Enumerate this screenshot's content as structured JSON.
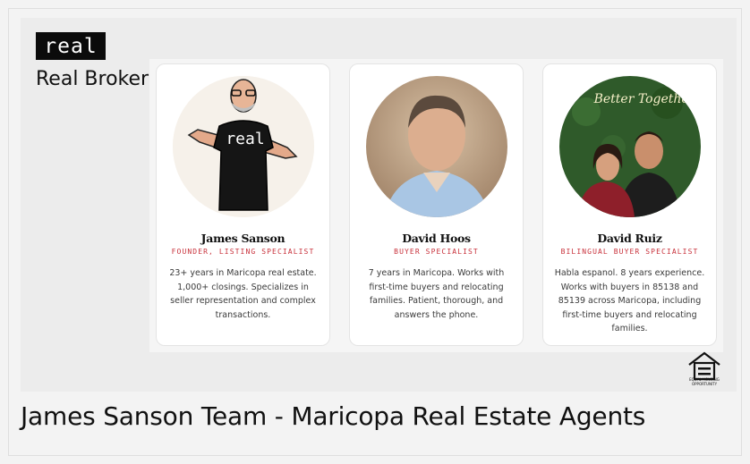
{
  "brand": {
    "logo_text": "real",
    "name": "Real Broker"
  },
  "agents": [
    {
      "name": "James Sanson",
      "role": "FOUNDER, LISTING SPECIALIST",
      "bio": "23+ years in Maricopa real estate. 1,000+ closings. Specializes in seller representation and complex transactions.",
      "shirt_text": "real"
    },
    {
      "name": "David Hoos",
      "role": "BUYER SPECIALIST",
      "bio": "7 years in Maricopa. Works with first-time buyers and relocating families. Patient, thorough, and answers the phone."
    },
    {
      "name": "David Ruiz",
      "role": "BILINGUAL BUYER SPECIALIST",
      "bio": "Habla espanol. 8 years experience. Works with buyers in 85138 and 85139 across Maricopa, including first-time buyers and relocating families.",
      "sign_text": "Better Together"
    }
  ],
  "equal_housing": {
    "label": "EQUAL HOUSING OPPORTUNITY",
    "icon": "equal-housing-icon"
  },
  "caption": "James Sanson Team - Maricopa Real Estate Agents",
  "colors": {
    "accent": "#c8313b",
    "logo_bg": "#0b0b0b"
  }
}
